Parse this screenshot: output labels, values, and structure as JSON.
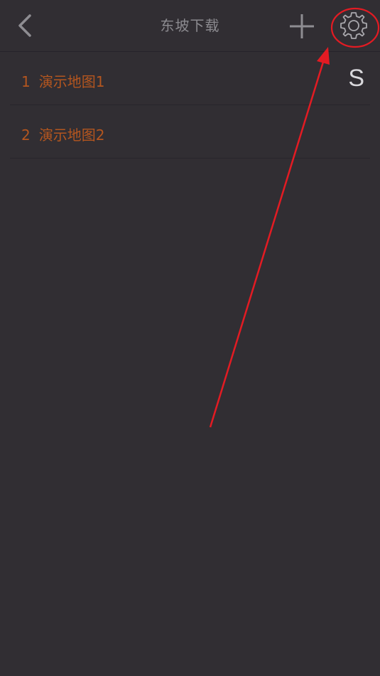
{
  "navbar": {
    "title": "东坡下载",
    "back_icon": "chevron-left-icon",
    "add_icon": "plus-icon",
    "settings_icon": "gear-icon"
  },
  "list": {
    "items": [
      {
        "number": "1",
        "label": "演示地图1",
        "badge": "S"
      },
      {
        "number": "2",
        "label": "演示地图2",
        "badge": ""
      }
    ]
  },
  "colors": {
    "background": "#312e33",
    "item_text": "#b4561f",
    "title_text": "#8b8a8f",
    "annotation": "#e31b23"
  }
}
